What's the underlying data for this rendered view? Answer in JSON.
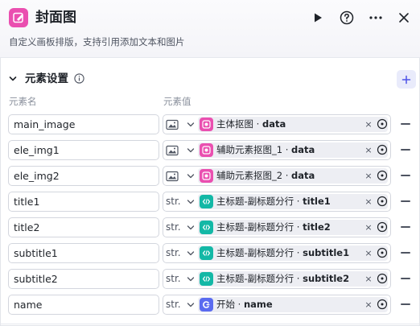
{
  "header": {
    "title": "封面图",
    "description": "自定义画板排版，支持引用添加文本和图片",
    "icon": "cover-image-node-icon",
    "accent_color": "#ea4fb0",
    "actions": [
      "run-icon",
      "help-icon",
      "more-icon",
      "close-icon"
    ]
  },
  "section": {
    "title": "元素设置",
    "info_icon": "info-icon",
    "add_icon": "plus-icon",
    "col_name_label": "元素名",
    "col_value_label": "元素值"
  },
  "rows": [
    {
      "name": "main_image",
      "type_icon": "image-icon",
      "type_label": "",
      "ref_icon": "image-node-icon",
      "ref_color": "#ea4fb0",
      "ref_source": "主体抠图",
      "ref_sep": " · ",
      "ref_var": "data"
    },
    {
      "name": "ele_img1",
      "type_icon": "image-icon",
      "type_label": "",
      "ref_icon": "image-node-icon",
      "ref_color": "#ea4fb0",
      "ref_source": "辅助元素抠图_1",
      "ref_sep": " · ",
      "ref_var": "data"
    },
    {
      "name": "ele_img2",
      "type_icon": "image-icon",
      "type_label": "",
      "ref_icon": "image-node-icon",
      "ref_color": "#ea4fb0",
      "ref_source": "辅助元素抠图_2",
      "ref_sep": " · ",
      "ref_var": "data"
    },
    {
      "name": "title1",
      "type_icon": "",
      "type_label": "str.",
      "ref_icon": "code-node-icon",
      "ref_color": "#13b8a6",
      "ref_source": "主标题-副标题分行",
      "ref_sep": " · ",
      "ref_var": "title1"
    },
    {
      "name": "title2",
      "type_icon": "",
      "type_label": "str.",
      "ref_icon": "code-node-icon",
      "ref_color": "#13b8a6",
      "ref_source": "主标题-副标题分行",
      "ref_sep": " · ",
      "ref_var": "title2"
    },
    {
      "name": "subtitle1",
      "type_icon": "",
      "type_label": "str.",
      "ref_icon": "code-node-icon",
      "ref_color": "#13b8a6",
      "ref_source": "主标题-副标题分行",
      "ref_sep": " · ",
      "ref_var": "subtitle1"
    },
    {
      "name": "subtitle2",
      "type_icon": "",
      "type_label": "str.",
      "ref_icon": "code-node-icon",
      "ref_color": "#13b8a6",
      "ref_source": "主标题-副标题分行",
      "ref_sep": " · ",
      "ref_var": "subtitle2"
    },
    {
      "name": "name",
      "type_icon": "",
      "type_label": "str.",
      "ref_icon": "start-node-icon",
      "ref_color": "#5a6bf0",
      "ref_source": "开始",
      "ref_sep": " · ",
      "ref_var": "name"
    }
  ],
  "ref_close_glyph": "×"
}
